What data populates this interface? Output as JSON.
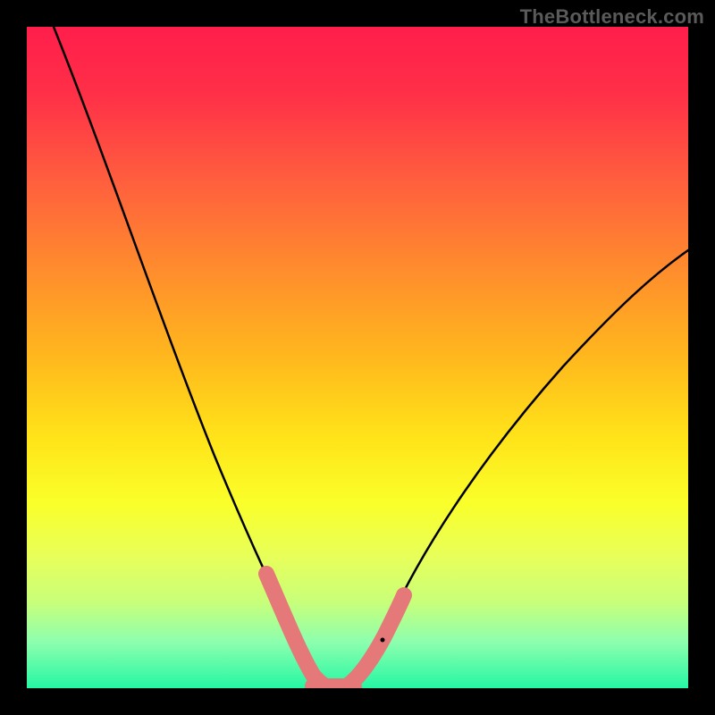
{
  "watermark": "TheBottleneck.com",
  "chart_data": {
    "type": "line",
    "title": "",
    "xlabel": "",
    "ylabel": "",
    "xlim": [
      0,
      100
    ],
    "ylim": [
      0,
      100
    ],
    "grid": false,
    "legend": false,
    "series": [
      {
        "name": "curve",
        "x": [
          4,
          10,
          15,
          20,
          25,
          30,
          35,
          38,
          40,
          42,
          44,
          45,
          48,
          52,
          55,
          60,
          65,
          70,
          75,
          80,
          85,
          90,
          95,
          100
        ],
        "y": [
          100,
          80,
          64,
          50,
          38,
          27,
          17,
          10,
          5,
          2,
          0,
          0,
          0,
          3,
          7,
          14,
          22,
          30,
          37,
          44,
          50,
          55,
          60,
          65
        ]
      }
    ],
    "annotations": {
      "pink_segments": [
        {
          "x_range": [
            35,
            44
          ],
          "side": "left"
        },
        {
          "x_range": [
            44,
            48
          ],
          "side": "bottom"
        },
        {
          "x_range": [
            48,
            55
          ],
          "side": "right"
        }
      ]
    },
    "background_gradient": {
      "stops": [
        {
          "pos": 0.0,
          "color": "#ff1e4b"
        },
        {
          "pos": 0.5,
          "color": "#ffe319"
        },
        {
          "pos": 1.0,
          "color": "#25f7a3"
        }
      ]
    }
  }
}
